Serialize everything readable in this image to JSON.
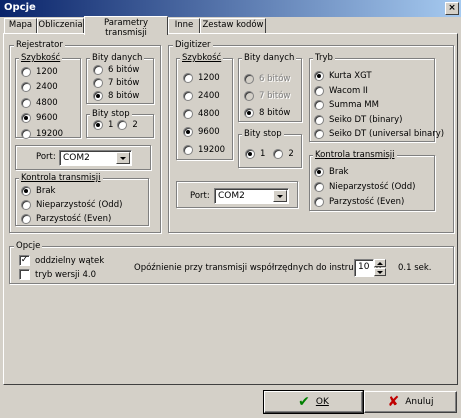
{
  "window": {
    "title": "Opcje",
    "close_glyph": "×"
  },
  "tabs": [
    {
      "label": "Mapa"
    },
    {
      "label": "Obliczenia"
    },
    {
      "label": "Parametry transmisji"
    },
    {
      "label": "Inne"
    },
    {
      "label": "Zestaw kodów"
    }
  ],
  "rejestrator": {
    "legend": "Rejestrator",
    "speed": {
      "legend": "Szybkość",
      "options": [
        "1200",
        "2400",
        "4800",
        "9600",
        "19200"
      ],
      "selected": "9600"
    },
    "data_bits": {
      "legend": "Bity danych",
      "options": [
        "6 bitów",
        "7 bitów",
        "8 bitów"
      ],
      "selected": "8 bitów"
    },
    "stop_bits": {
      "legend": "Bity stop",
      "options": [
        "1",
        "2"
      ],
      "selected": "1"
    },
    "port": {
      "label": "Port:",
      "value": "COM2"
    },
    "flow": {
      "legend": "Kontrola transmisji",
      "options": [
        "Brak",
        "Nieparzystość (Odd)",
        "Parzystość (Even)"
      ],
      "selected": "Brak"
    }
  },
  "digitizer": {
    "legend": "Digitizer",
    "speed": {
      "legend": "Szybkość",
      "options": [
        "1200",
        "2400",
        "4800",
        "9600",
        "19200"
      ],
      "selected": "9600"
    },
    "data_bits": {
      "legend": "Bity danych",
      "options": [
        "6 bitów",
        "7 bitów",
        "8 bitów"
      ],
      "selected": "8 bitów"
    },
    "stop_bits": {
      "legend": "Bity stop",
      "options": [
        "1",
        "2"
      ],
      "selected": "1"
    },
    "port": {
      "label": "Port:",
      "value": "COM2"
    },
    "mode": {
      "legend": "Tryb",
      "options": [
        "Kurta XGT",
        "Wacom II",
        "Summa MM",
        "Seiko DT (binary)",
        "Seiko DT (universal binary)"
      ],
      "selected": "Kurta XGT"
    },
    "flow": {
      "legend": "Kontrola transmisji",
      "options": [
        "Brak",
        "Nieparzystość (Odd)",
        "Parzystość (Even)"
      ],
      "selected": "Brak"
    }
  },
  "options": {
    "legend": "Opcje",
    "separate_thread": {
      "label": "oddzielny wątek",
      "checked": true
    },
    "version4": {
      "label": "tryb wersji 4.0",
      "checked": false
    },
    "delay": {
      "label": "Opóźnienie przy transmisji współrzędnych do instrumentu:",
      "value": "10",
      "unit": "0.1 sek."
    }
  },
  "buttons": {
    "ok": {
      "label": "OK",
      "icon": "check-icon",
      "color": "#008000"
    },
    "cancel": {
      "label": "Anuluj",
      "icon": "x-icon",
      "color": "#c00000"
    }
  }
}
